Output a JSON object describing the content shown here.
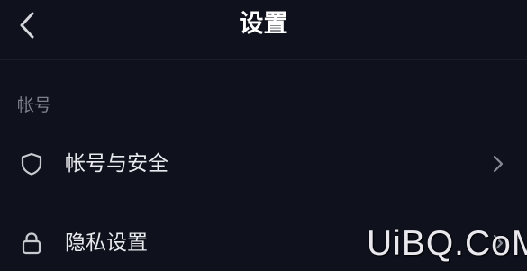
{
  "header": {
    "title": "设置",
    "back_icon": "chevron-left-icon"
  },
  "sections": [
    {
      "label": "帐号",
      "items": [
        {
          "label": "帐号与安全",
          "icon": "shield-icon",
          "trailing_icon": "chevron-right-icon"
        },
        {
          "label": "隐私设置",
          "icon": "lock-icon",
          "trailing_icon": "chevron-right-icon"
        }
      ]
    }
  ],
  "watermark": "UiBQ.CoM",
  "colors": {
    "background": "#0f111c",
    "title_text": "#ffffff",
    "section_label_text": "#7e808a",
    "row_text": "#e9eaee",
    "icon": "#c9cad0",
    "chevron": "#8a8c95"
  }
}
